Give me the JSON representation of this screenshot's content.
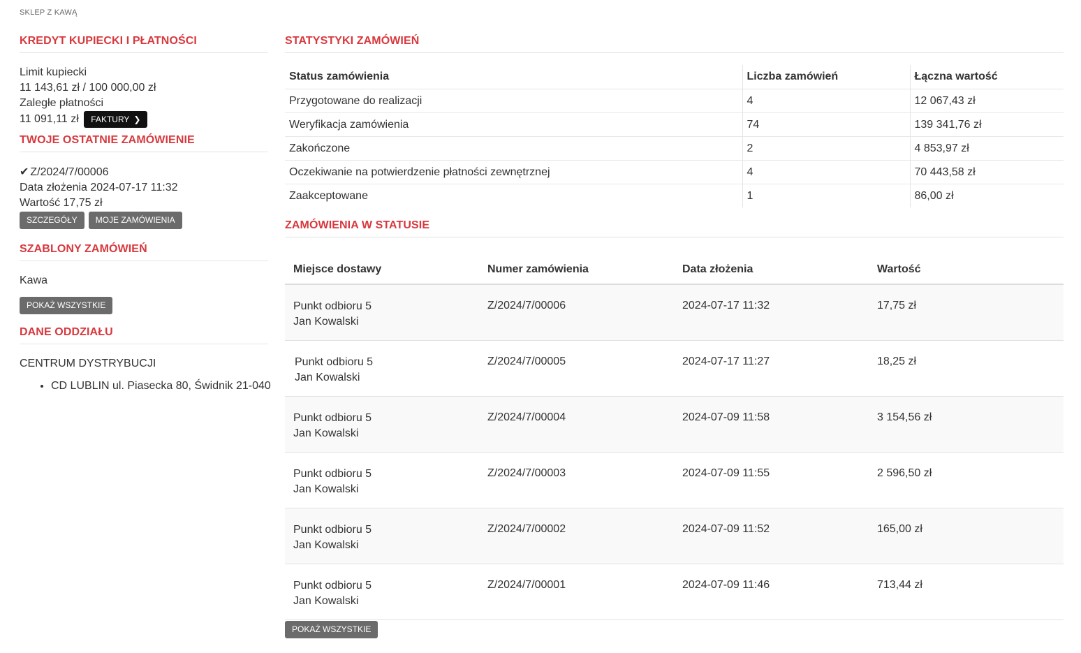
{
  "breadcrumb": "SKLEP Z KAWĄ",
  "credit": {
    "title": "KREDYT KUPIECKI I PŁATNOŚCI",
    "limit_label": "Limit kupiecki",
    "limit_value": "11 143,61 zł / 100 000,00 zł",
    "overdue_label": "Zaległe płatności",
    "overdue_value": "11 091,11 zł",
    "invoices_button": "FAKTURY"
  },
  "last_order": {
    "title": "TWOJE OSTATNIE ZAMÓWIENIE",
    "number": "Z/2024/7/00006",
    "date_line": "Data złożenia 2024-07-17 11:32",
    "value_line": "Wartość 17,75 zł",
    "details_button": "SZCZEGÓŁY",
    "my_orders_button": "MOJE ZAMÓWIENIA"
  },
  "templates": {
    "title": "SZABLONY ZAMÓWIEŃ",
    "items": [
      "Kawa"
    ],
    "show_all_button": "POKAŻ WSZYSTKIE"
  },
  "branch": {
    "title": "DANE ODDZIAŁU",
    "name": "CENTRUM DYSTRYBUCJI",
    "addresses": [
      "CD LUBLIN ul. Piasecka 80, Świdnik 21-040"
    ]
  },
  "stats": {
    "title": "STATYSTYKI ZAMÓWIEŃ",
    "headers": [
      "Status zamówienia",
      "Liczba zamówień",
      "Łączna wartość"
    ],
    "rows": [
      [
        "Przygotowane do realizacji",
        "4",
        "12 067,43 zł"
      ],
      [
        "Weryfikacja zamówienia",
        "74",
        "139 341,76 zł"
      ],
      [
        "Zakończone",
        "2",
        "4 853,97 zł"
      ],
      [
        "Oczekiwanie na potwierdzenie płatności zewnętrznej",
        "4",
        "70 443,58 zł"
      ],
      [
        "Zaakceptowane",
        "1",
        "86,00 zł"
      ]
    ]
  },
  "orders": {
    "title": "ZAMÓWIENIA W STATUSIE",
    "headers": [
      "Miejsce dostawy",
      "Numer zamówienia",
      "Data złożenia",
      "Wartość"
    ],
    "rows": [
      {
        "place": "Punkt odbioru 5",
        "person": "Jan Kowalski",
        "number": "Z/2024/7/00006",
        "date": "2024-07-17 11:32",
        "value": "17,75 zł"
      },
      {
        "place": "Punkt odbioru 5",
        "person": "Jan Kowalski",
        "number": "Z/2024/7/00005",
        "date": "2024-07-17 11:27",
        "value": "18,25 zł"
      },
      {
        "place": "Punkt odbioru 5",
        "person": "Jan Kowalski",
        "number": "Z/2024/7/00004",
        "date": "2024-07-09 11:58",
        "value": "3 154,56 zł"
      },
      {
        "place": "Punkt odbioru 5",
        "person": "Jan Kowalski",
        "number": "Z/2024/7/00003",
        "date": "2024-07-09 11:55",
        "value": "2 596,50 zł"
      },
      {
        "place": "Punkt odbioru 5",
        "person": "Jan Kowalski",
        "number": "Z/2024/7/00002",
        "date": "2024-07-09 11:52",
        "value": "165,00 zł"
      },
      {
        "place": "Punkt odbioru 5",
        "person": "Jan Kowalski",
        "number": "Z/2024/7/00001",
        "date": "2024-07-09 11:46",
        "value": "713,44 zł"
      }
    ],
    "show_all_button": "POKAŻ WSZYSTKIE"
  },
  "colors": {
    "accent": "#d8383d",
    "dark_button": "#111111",
    "grey_button": "#6b6b6b",
    "stripe": "#f9f9f9"
  },
  "icons": {
    "check": "check-icon",
    "chevron": "chevron-right-icon"
  }
}
